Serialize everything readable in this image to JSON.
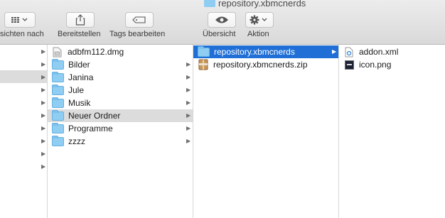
{
  "window": {
    "title": "repository.xbmcnerds"
  },
  "toolbar": {
    "view_label": "sichten nach",
    "share_label": "Bereitstellen",
    "tags_label": "Tags bearbeiten",
    "quicklook_label": "Übersicht",
    "action_label": "Aktion"
  },
  "column1": {
    "items": [
      "adbfm112.dmg",
      "Bilder",
      "Janina",
      "Jule",
      "Musik",
      "Neuer Ordner",
      "Programme",
      "zzzz"
    ]
  },
  "column2": {
    "items": [
      "repository.xbmcnerds",
      "repository.xbmcnerds.zip"
    ]
  },
  "column3": {
    "items": [
      "addon.xml",
      "icon.png"
    ]
  },
  "colors": {
    "selection": "#1f6fd6",
    "inactive_selection": "#dcdcdc",
    "folder": "#8fcdf2"
  }
}
